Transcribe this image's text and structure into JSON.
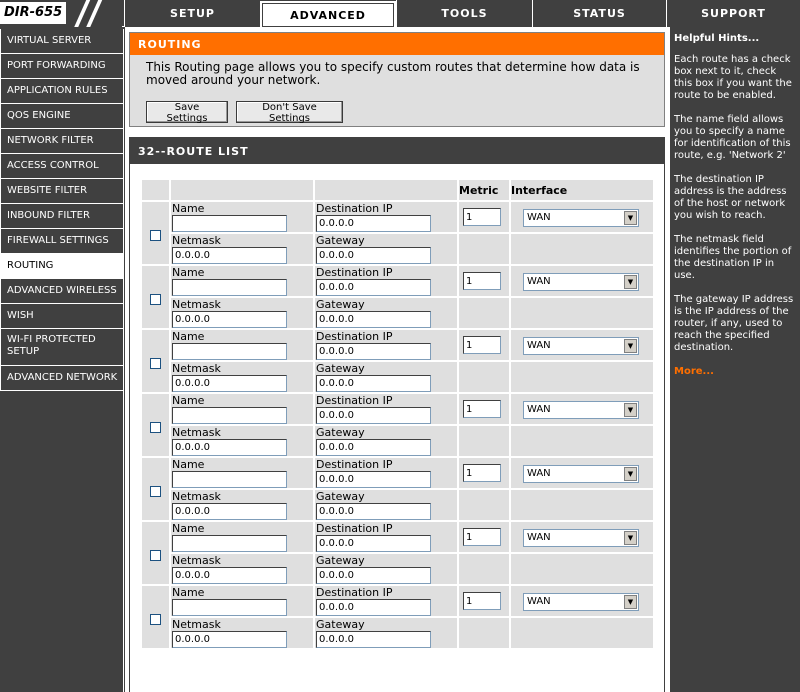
{
  "logo": {
    "model": "DIR-655"
  },
  "tabs": [
    {
      "label": "SETUP",
      "active": false
    },
    {
      "label": "ADVANCED",
      "active": true
    },
    {
      "label": "TOOLS",
      "active": false
    },
    {
      "label": "STATUS",
      "active": false
    },
    {
      "label": "SUPPORT",
      "active": false
    }
  ],
  "sidebar": {
    "items": [
      {
        "label": "VIRTUAL SERVER",
        "active": false
      },
      {
        "label": "PORT FORWARDING",
        "active": false
      },
      {
        "label": "APPLICATION RULES",
        "active": false
      },
      {
        "label": "QOS ENGINE",
        "active": false
      },
      {
        "label": "NETWORK FILTER",
        "active": false
      },
      {
        "label": "ACCESS CONTROL",
        "active": false
      },
      {
        "label": "WEBSITE FILTER",
        "active": false
      },
      {
        "label": "INBOUND FILTER",
        "active": false
      },
      {
        "label": "FIREWALL SETTINGS",
        "active": false
      },
      {
        "label": "ROUTING",
        "active": true
      },
      {
        "label": "ADVANCED WIRELESS",
        "active": false
      },
      {
        "label": "WISH",
        "active": false
      },
      {
        "label": "WI-FI PROTECTED SETUP",
        "active": false
      },
      {
        "label": "ADVANCED NETWORK",
        "active": false
      }
    ]
  },
  "routing": {
    "title": "ROUTING",
    "description": "This Routing page allows you to specify custom routes that determine how data is moved around your network.",
    "save_label": "Save Settings",
    "dont_save_label": "Don't Save Settings"
  },
  "route_list": {
    "title": "32--ROUTE LIST",
    "headers": {
      "metric": "Metric",
      "interface": "Interface"
    },
    "labels": {
      "name": "Name",
      "destination": "Destination IP",
      "netmask": "Netmask",
      "gateway": "Gateway"
    },
    "rows": [
      {
        "name": "",
        "destination": "0.0.0.0",
        "netmask": "0.0.0.0",
        "gateway": "0.0.0.0",
        "metric": "1",
        "interface": "WAN",
        "checked": false
      },
      {
        "name": "",
        "destination": "0.0.0.0",
        "netmask": "0.0.0.0",
        "gateway": "0.0.0.0",
        "metric": "1",
        "interface": "WAN",
        "checked": false
      },
      {
        "name": "",
        "destination": "0.0.0.0",
        "netmask": "0.0.0.0",
        "gateway": "0.0.0.0",
        "metric": "1",
        "interface": "WAN",
        "checked": false
      },
      {
        "name": "",
        "destination": "0.0.0.0",
        "netmask": "0.0.0.0",
        "gateway": "0.0.0.0",
        "metric": "1",
        "interface": "WAN",
        "checked": false
      },
      {
        "name": "",
        "destination": "0.0.0.0",
        "netmask": "0.0.0.0",
        "gateway": "0.0.0.0",
        "metric": "1",
        "interface": "WAN",
        "checked": false
      },
      {
        "name": "",
        "destination": "0.0.0.0",
        "netmask": "0.0.0.0",
        "gateway": "0.0.0.0",
        "metric": "1",
        "interface": "WAN",
        "checked": false
      },
      {
        "name": "",
        "destination": "0.0.0.0",
        "netmask": "0.0.0.0",
        "gateway": "0.0.0.0",
        "metric": "1",
        "interface": "WAN",
        "checked": false
      }
    ]
  },
  "hints": {
    "title": "Helpful Hints...",
    "paragraphs": [
      "Each route has a check box next to it, check this box if you want the route to be enabled.",
      "The name field allows you to specify a name for identification of this route, e.g. 'Network 2'",
      "The destination IP address is the address of the host or network you wish to reach.",
      "The netmask field identifies the portion of the destination IP in use.",
      "The gateway IP address is the IP address of the router, if any, used to reach the specified destination."
    ],
    "more": "More..."
  },
  "colors": {
    "accent": "#ff6f00",
    "chrome": "#404040",
    "panel": "#dfdfdf"
  }
}
